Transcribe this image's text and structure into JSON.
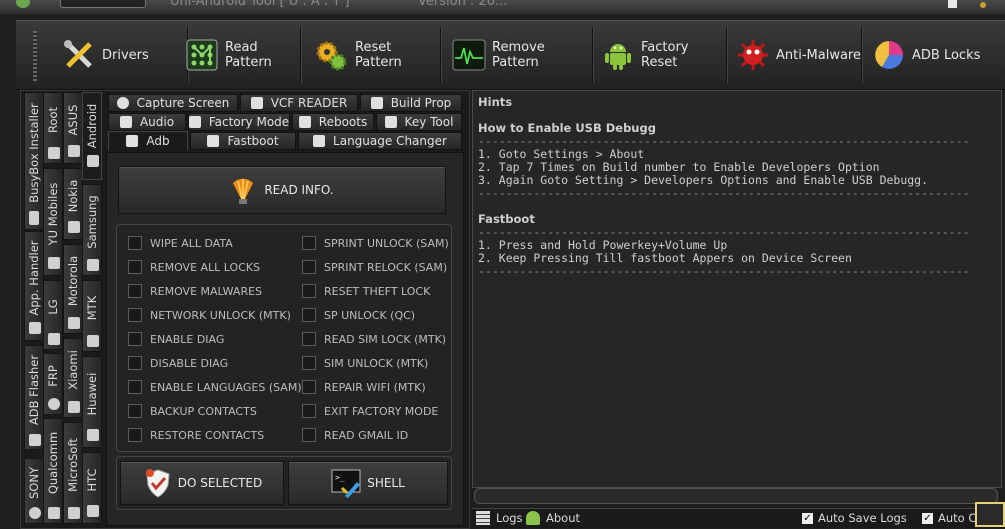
{
  "titlebar": {
    "title": "Uni-Android Tool  [ U : A : T ]",
    "version": "Version : 20..."
  },
  "toolbar": [
    {
      "label": "Drivers",
      "icon": "tools-icon"
    },
    {
      "label": "Read Pattern",
      "icon": "pattern-grid-icon"
    },
    {
      "label": "Reset Pattern",
      "icon": "gears-icon"
    },
    {
      "label": "Remove Pattern",
      "icon": "oscilloscope-icon"
    },
    {
      "label": "Factory Reset",
      "icon": "android-robot-icon"
    },
    {
      "label": "Anti-Malware",
      "icon": "virus-icon"
    },
    {
      "label": "ADB Locks",
      "icon": "pie-chart-icon"
    }
  ],
  "vertical_tabs": {
    "col1": [
      "BusyBox Installer",
      "App. Handler",
      "ADB Flasher",
      "SONY"
    ],
    "col2": [
      "Root",
      "YU Mobiles",
      "LG",
      "FRP",
      "Qualcomm"
    ],
    "col3": [
      "ASUS",
      "Nokia",
      "Motorola",
      "Xiaomi",
      "MicroSoft"
    ],
    "col4": [
      "Android",
      "Samsung",
      "MTK",
      "Huawei",
      "HTC"
    ]
  },
  "tabs_row1": [
    "Capture Screen",
    "VCF READER",
    "Build Prop"
  ],
  "tabs_row2": [
    "Audio",
    "Factory Mode",
    "Reboots",
    "Key Tool"
  ],
  "tabs_row3": [
    "Adb",
    "Fastboot",
    "Language Changer"
  ],
  "read_info_label": "READ INFO.",
  "options_left": [
    "WIPE ALL DATA",
    "REMOVE ALL LOCKS",
    "REMOVE MALWARES",
    "NETWORK UNLOCK (MTK)",
    "ENABLE DIAG",
    "DISABLE DIAG",
    "ENABLE LANGUAGES (SAM)",
    "BACKUP CONTACTS",
    "RESTORE CONTACTS"
  ],
  "options_right": [
    "SPRINT UNLOCK (SAM)",
    "SPRINT RELOCK (SAM)",
    "RESET THEFT LOCK",
    "SP UNLOCK (QC)",
    "READ SIM LOCK (MTK)",
    "SIM UNLOCK (MTK)",
    "REPAIR WIFI (MTK)",
    "EXIT FACTORY MODE",
    "READ GMAIL ID"
  ],
  "do_selected_label": "DO SELECTED",
  "shell_label": "SHELL",
  "hints": {
    "title": "Hints",
    "usb_heading": "How to Enable USB Debugg",
    "sep": "-----------------------------------------------------------------------",
    "usb_steps": [
      "1. Goto Settings > About",
      "2. Tap 7 Times on Build number to Enable Developers Option",
      "3. Again Goto Setting > Developers Options and Enable USB Debugg."
    ],
    "fastboot_heading": "Fastboot",
    "fastboot_steps": [
      "1. Press and Hold Powerkey+Volume Up",
      "2. Keep Pressing Till fastboot Appers on Device Screen"
    ]
  },
  "bottom": {
    "logs": "Logs",
    "about": "About",
    "auto_save": "Auto Save Logs",
    "auto_other": "Auto C"
  }
}
